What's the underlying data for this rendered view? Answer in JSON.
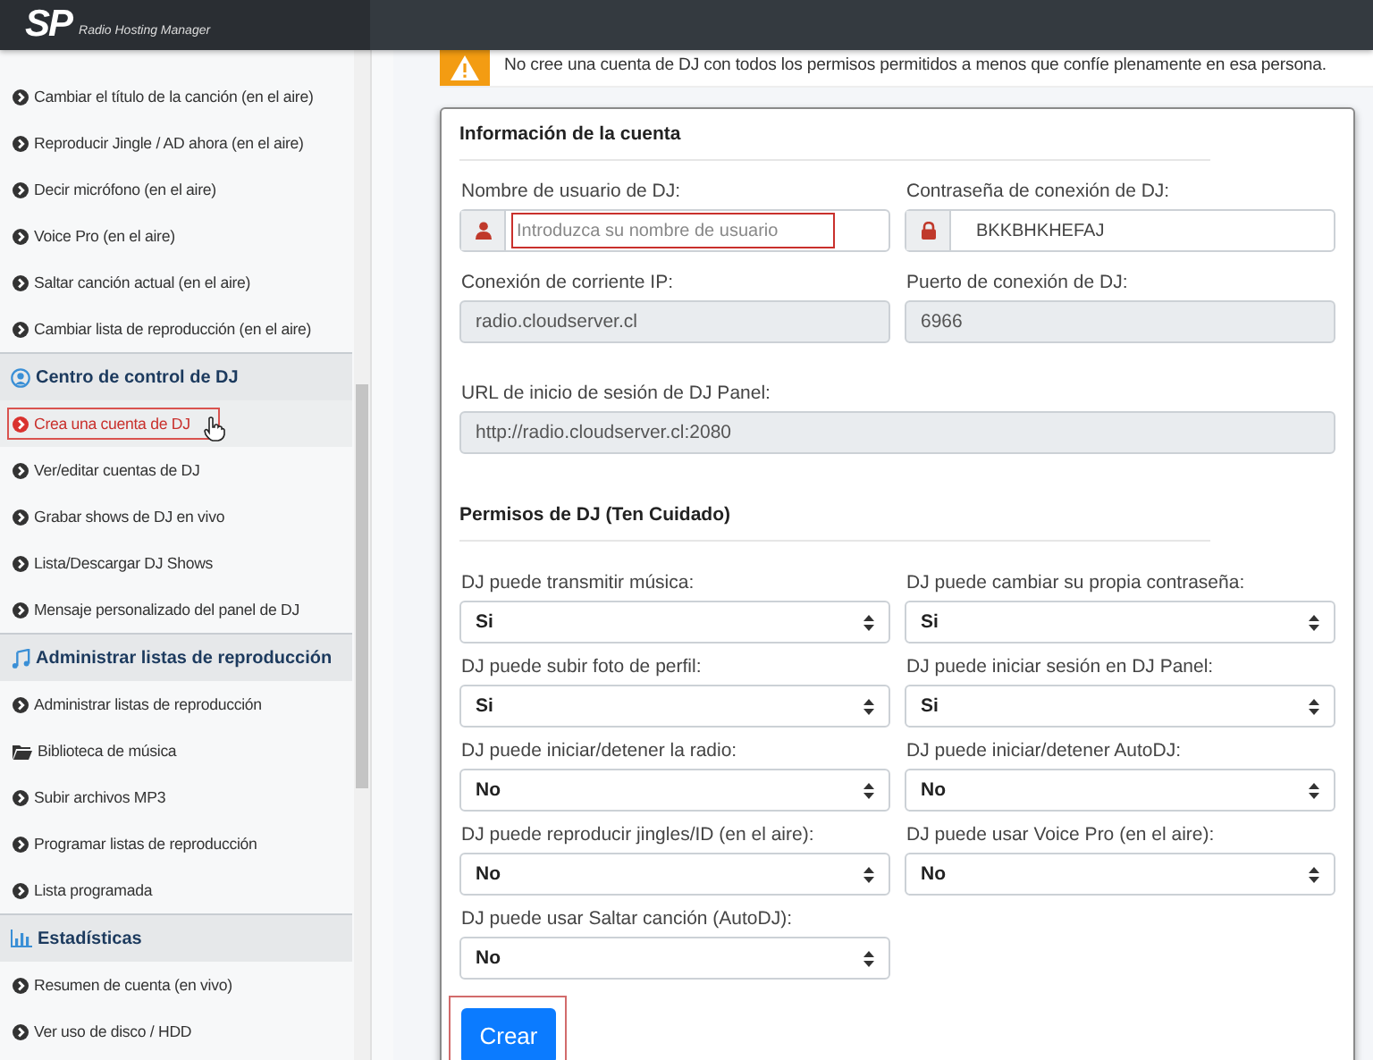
{
  "header": {
    "logo": "SP",
    "tagline": "Radio Hosting Manager"
  },
  "sidebar": {
    "groups": [
      {
        "items": [
          {
            "label": "Cambiar el título de la canción (en el aire)",
            "selected": false
          },
          {
            "label": "Reproducir Jingle / AD ahora (en el aire)",
            "selected": false
          },
          {
            "label": "Decir micrófono (en el aire)",
            "selected": false
          },
          {
            "label": "Voice Pro (en el aire)",
            "selected": false
          },
          {
            "label": "Saltar canción actual (en el aire)",
            "selected": false
          },
          {
            "label": "Cambiar lista de reproducción (en el aire)",
            "selected": false
          }
        ]
      },
      {
        "title": "Centro de control de DJ",
        "items": [
          {
            "label": "Crea una cuenta de DJ",
            "selected": true
          },
          {
            "label": "Ver/editar cuentas de DJ",
            "selected": false
          },
          {
            "label": "Grabar shows de DJ en vivo",
            "selected": false
          },
          {
            "label": "Lista/Descargar DJ Shows",
            "selected": false
          },
          {
            "label": "Mensaje personalizado del panel de DJ",
            "selected": false
          }
        ]
      },
      {
        "title": "Administrar listas de reproducción",
        "items": [
          {
            "label": "Administrar listas de reproducción",
            "selected": false
          },
          {
            "label": "Biblioteca de música",
            "selected": false
          },
          {
            "label": "Subir archivos MP3",
            "selected": false
          },
          {
            "label": "Programar listas de reproducción",
            "selected": false
          },
          {
            "label": "Lista programada",
            "selected": false
          }
        ]
      },
      {
        "title": "Estadísticas",
        "items": [
          {
            "label": "Resumen de cuenta (en vivo)",
            "selected": false
          },
          {
            "label": "Ver uso de disco / HDD",
            "selected": false
          }
        ]
      }
    ]
  },
  "alert": {
    "text": "No cree una cuenta de DJ con todos los permisos permitidos a menos que confíe plenamente en esa persona."
  },
  "account": {
    "title": "Información de la cuenta",
    "fields": [
      {
        "label": "Nombre de usuario de DJ:",
        "kind": "user",
        "placeholder": "Introduzca su nombre de usuario",
        "readonly": false,
        "highlighted": true
      },
      {
        "label": "Contraseña de conexión de DJ:",
        "kind": "password",
        "value": "BKKBHKHEFAJ",
        "readonly": false,
        "highlighted": false
      },
      {
        "label": "Conexión de corriente IP:",
        "kind": "plain",
        "value": "radio.cloudserver.cl",
        "readonly": true,
        "highlighted": false
      },
      {
        "label": "Puerto de conexión de DJ:",
        "kind": "plain",
        "value": "6966",
        "readonly": true,
        "highlighted": false
      },
      {
        "label": "URL de inicio de sesión de DJ Panel:",
        "kind": "wide",
        "value": "http://radio.cloudserver.cl:2080",
        "readonly": true,
        "highlighted": false
      }
    ]
  },
  "permissions": {
    "title": "Permisos de DJ (Ten Cuidado)",
    "selects": [
      {
        "label": "DJ puede transmitir música:",
        "value": "Si"
      },
      {
        "label": "DJ puede cambiar su propia contraseña:",
        "value": "Si"
      },
      {
        "label": "DJ puede subir foto de perfil:",
        "value": "Si"
      },
      {
        "label": "DJ puede iniciar sesión en DJ Panel:",
        "value": "Si"
      },
      {
        "label": "DJ puede iniciar/detener la radio:",
        "value": "No"
      },
      {
        "label": "DJ puede iniciar/detener AutoDJ:",
        "value": "No"
      },
      {
        "label": "DJ puede reproducir jingles/ID (en el aire):",
        "value": "No"
      },
      {
        "label": "DJ puede usar Voice Pro (en el aire):",
        "value": "No"
      },
      {
        "label": "DJ puede usar Saltar canción (AutoDJ):",
        "value": "No"
      }
    ]
  },
  "submit": {
    "label": "Crear",
    "highlighted": true
  }
}
